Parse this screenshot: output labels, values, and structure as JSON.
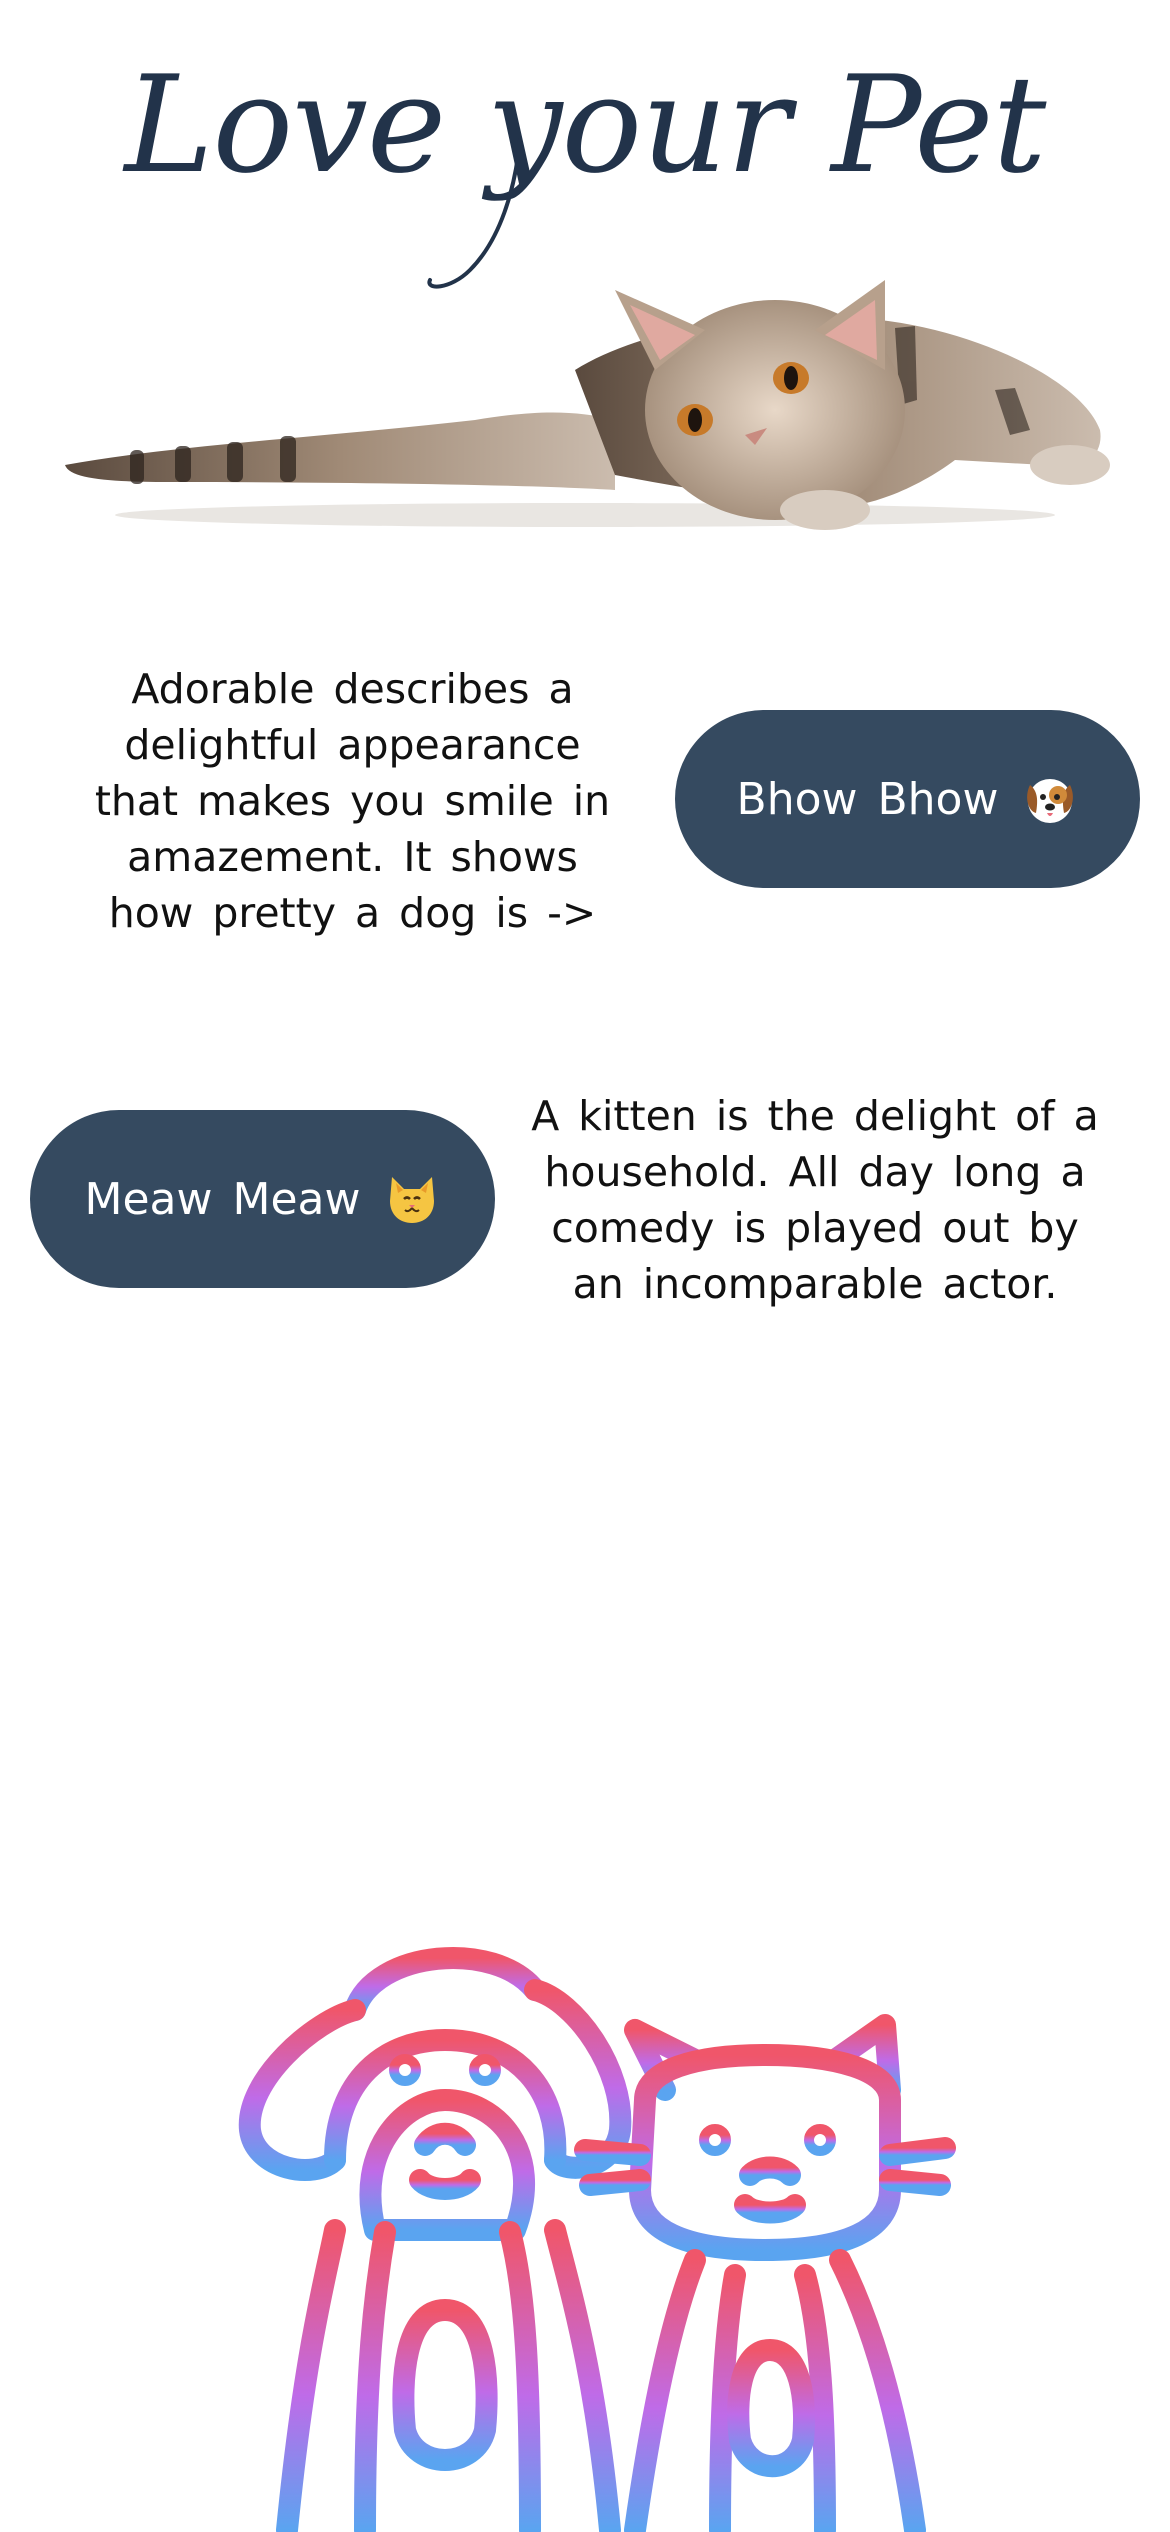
{
  "header": {
    "title": "Love your Pet"
  },
  "sections": {
    "dog": {
      "description": "Adorable describes a delightful appearance that makes you smile in amazement. It shows how pretty a dog is ->",
      "button_label": "Bhow Bhow",
      "button_icon": "dog-face-icon"
    },
    "cat": {
      "description": "A kitten is the delight of a household. All day long a comedy is played out by an incomparable actor.",
      "button_label": "Meaw Meaw",
      "button_icon": "cat-face-icon"
    }
  },
  "colors": {
    "title": "#22334a",
    "button_bg": "#354a60",
    "button_text": "#ffffff",
    "gradient_top": "#f0566a",
    "gradient_mid": "#bf6be8",
    "gradient_bottom": "#5aa4f0"
  },
  "images": {
    "hero": "lying-tabby-kitten-photo",
    "footer": "dog-and-cat-outline-illustration"
  }
}
